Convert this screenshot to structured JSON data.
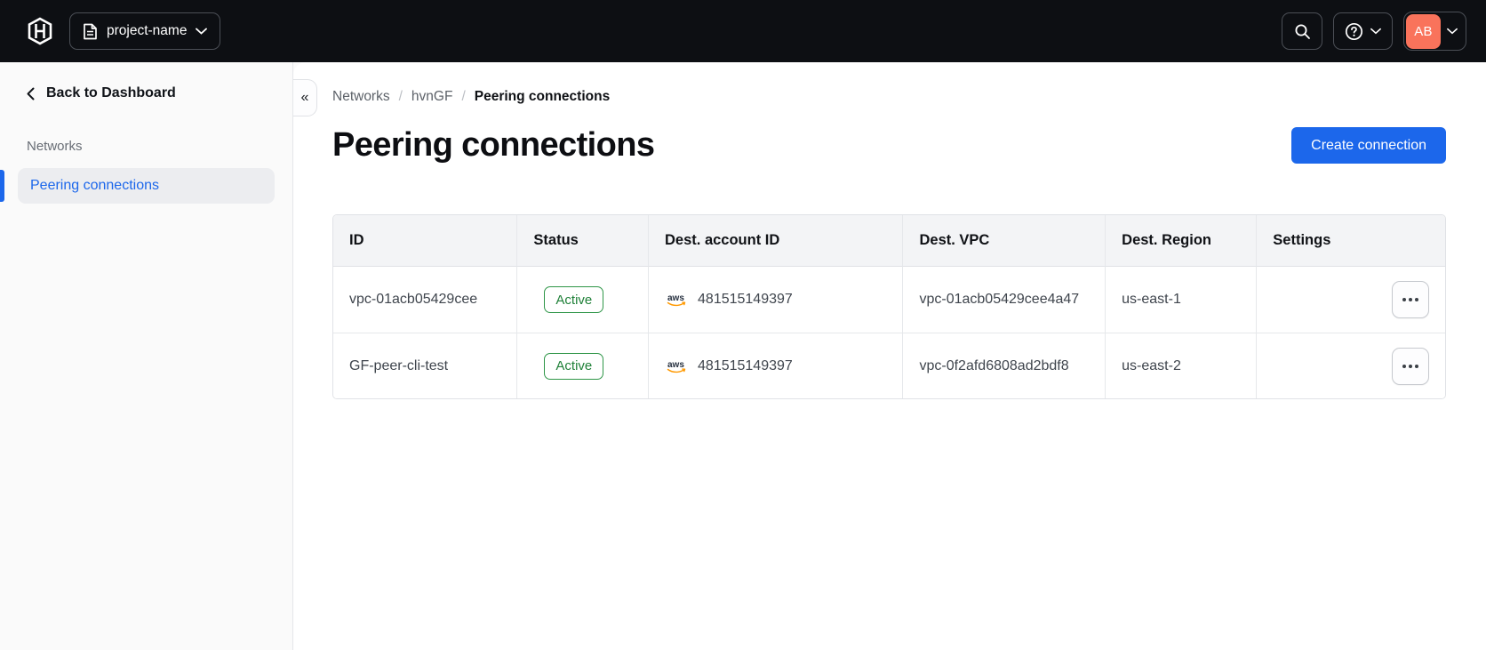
{
  "topbar": {
    "project_switcher_label": "project-name",
    "avatar_initials": "AB"
  },
  "sidebar": {
    "back_label": "Back to Dashboard",
    "section_label": "Networks",
    "items": [
      {
        "label": "Peering connections",
        "active": true
      }
    ],
    "collapse_glyph": "«"
  },
  "breadcrumb": {
    "separator": "/",
    "items": [
      {
        "label": "Networks"
      },
      {
        "label": "hvnGF"
      },
      {
        "label": "Peering connections",
        "current": true
      }
    ]
  },
  "page": {
    "title": "Peering connections",
    "create_button_label": "Create connection"
  },
  "table": {
    "columns": [
      "ID",
      "Status",
      "Dest. account ID",
      "Dest. VPC",
      "Dest. Region",
      "Settings"
    ],
    "rows": [
      {
        "id": "vpc-01acb05429cee",
        "status": "Active",
        "dest_account_provider": "aws",
        "dest_account_id": "481515149397",
        "dest_vpc": "vpc-01acb05429cee4a47",
        "dest_region": "us-east-1"
      },
      {
        "id": "GF-peer-cli-test",
        "status": "Active",
        "dest_account_provider": "aws",
        "dest_account_id": "481515149397",
        "dest_vpc": "vpc-0f2afd6808ad2bdf8",
        "dest_region": "us-east-2"
      }
    ]
  },
  "colors": {
    "topbar_bg": "#0d0f13",
    "accent_blue": "#1c67eb",
    "avatar_orange": "#f9735b",
    "badge_green_text": "#1f8038",
    "badge_green_border": "#2f9648",
    "aws_orange": "#ff9900",
    "sidebar_bg": "#fafafa",
    "table_header_bg": "#f3f4f6"
  }
}
